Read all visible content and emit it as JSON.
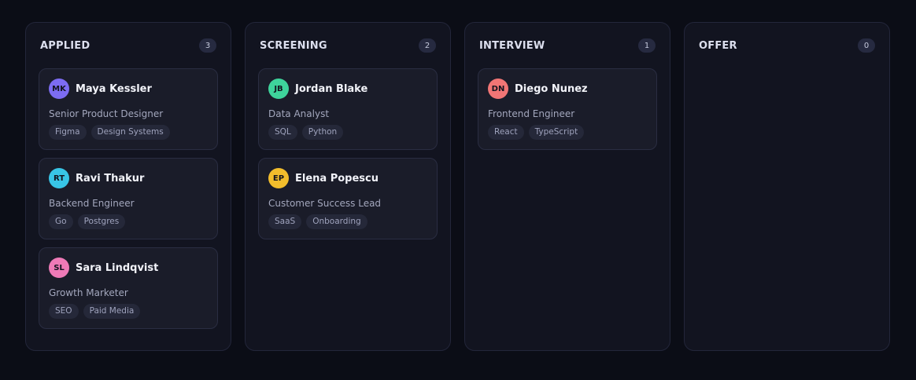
{
  "columns": [
    {
      "title": "APPLIED",
      "count": "3",
      "cards": [
        {
          "initials": "MK",
          "avatar_color": "#7c6cf2",
          "name": "Maya Kessler",
          "role": "Senior Product Designer",
          "tags": [
            "Figma",
            "Design Systems"
          ]
        },
        {
          "initials": "RT",
          "avatar_color": "#38c5e6",
          "name": "Ravi Thakur",
          "role": "Backend Engineer",
          "tags": [
            "Go",
            "Postgres"
          ]
        },
        {
          "initials": "SL",
          "avatar_color": "#ee7ab7",
          "name": "Sara Lindqvist",
          "role": "Growth Marketer",
          "tags": [
            "SEO",
            "Paid Media"
          ]
        }
      ]
    },
    {
      "title": "SCREENING",
      "count": "2",
      "cards": [
        {
          "initials": "JB",
          "avatar_color": "#3ed39b",
          "name": "Jordan Blake",
          "role": "Data Analyst",
          "tags": [
            "SQL",
            "Python"
          ]
        },
        {
          "initials": "EP",
          "avatar_color": "#f2bd2c",
          "name": "Elena Popescu",
          "role": "Customer Success Lead",
          "tags": [
            "SaaS",
            "Onboarding"
          ]
        }
      ]
    },
    {
      "title": "INTERVIEW",
      "count": "1",
      "cards": [
        {
          "initials": "DN",
          "avatar_color": "#f17575",
          "name": "Diego Nunez",
          "role": "Frontend Engineer",
          "tags": [
            "React",
            "TypeScript"
          ]
        }
      ]
    },
    {
      "title": "OFFER",
      "count": "0",
      "cards": []
    }
  ]
}
